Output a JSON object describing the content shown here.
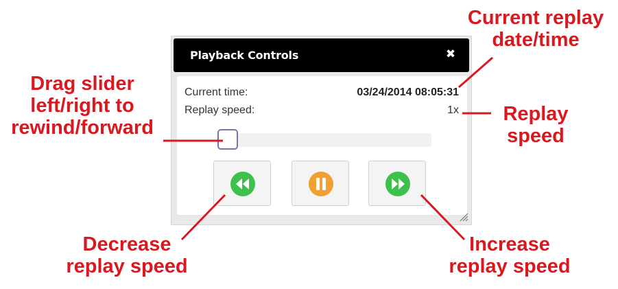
{
  "dialog": {
    "title": "Playback Controls",
    "close_glyph": "✖",
    "current_time_label": "Current time:",
    "current_time_value": "03/24/2014 08:05:31",
    "replay_speed_label": "Replay speed:",
    "replay_speed_value": "1x",
    "slider_position": 0.03,
    "buttons": [
      {
        "name": "decrease-speed",
        "icon": "rewind-icon",
        "color": "#3ec14a"
      },
      {
        "name": "pause",
        "icon": "pause-icon",
        "color": "#f0a030"
      },
      {
        "name": "increase-speed",
        "icon": "fast-forward-icon",
        "color": "#3ec14a"
      }
    ]
  },
  "annotations": {
    "current_time": [
      "Current replay",
      "date/time"
    ],
    "replay_speed": [
      "Replay",
      "speed"
    ],
    "slider": [
      "Drag slider",
      "left/right to",
      "rewind/forward"
    ],
    "decrease": [
      "Decrease",
      "replay speed"
    ],
    "increase": [
      "Increase",
      "replay speed"
    ],
    "color": "#d71920"
  }
}
